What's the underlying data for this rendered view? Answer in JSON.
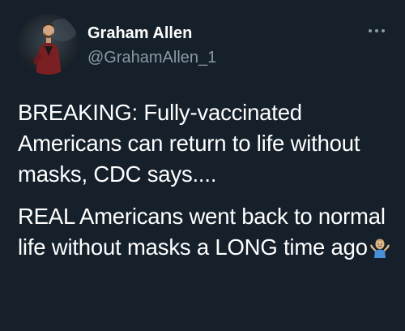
{
  "author": {
    "display_name": "Graham Allen",
    "handle": "@GrahamAllen_1",
    "avatar_icon": "profile-photo"
  },
  "menu": {
    "icon": "more-horizontal-icon"
  },
  "tweet": {
    "paragraph_1": "BREAKING: Fully-vaccinated Americans can return to life without masks, CDC says....",
    "paragraph_2": "REAL Americans went back to normal life without masks a LONG time ago",
    "trailing_emoji": "person-shrugging-emoji"
  },
  "colors": {
    "background": "#15202b",
    "text_primary": "#ffffff",
    "text_secondary": "#8b98a5"
  }
}
